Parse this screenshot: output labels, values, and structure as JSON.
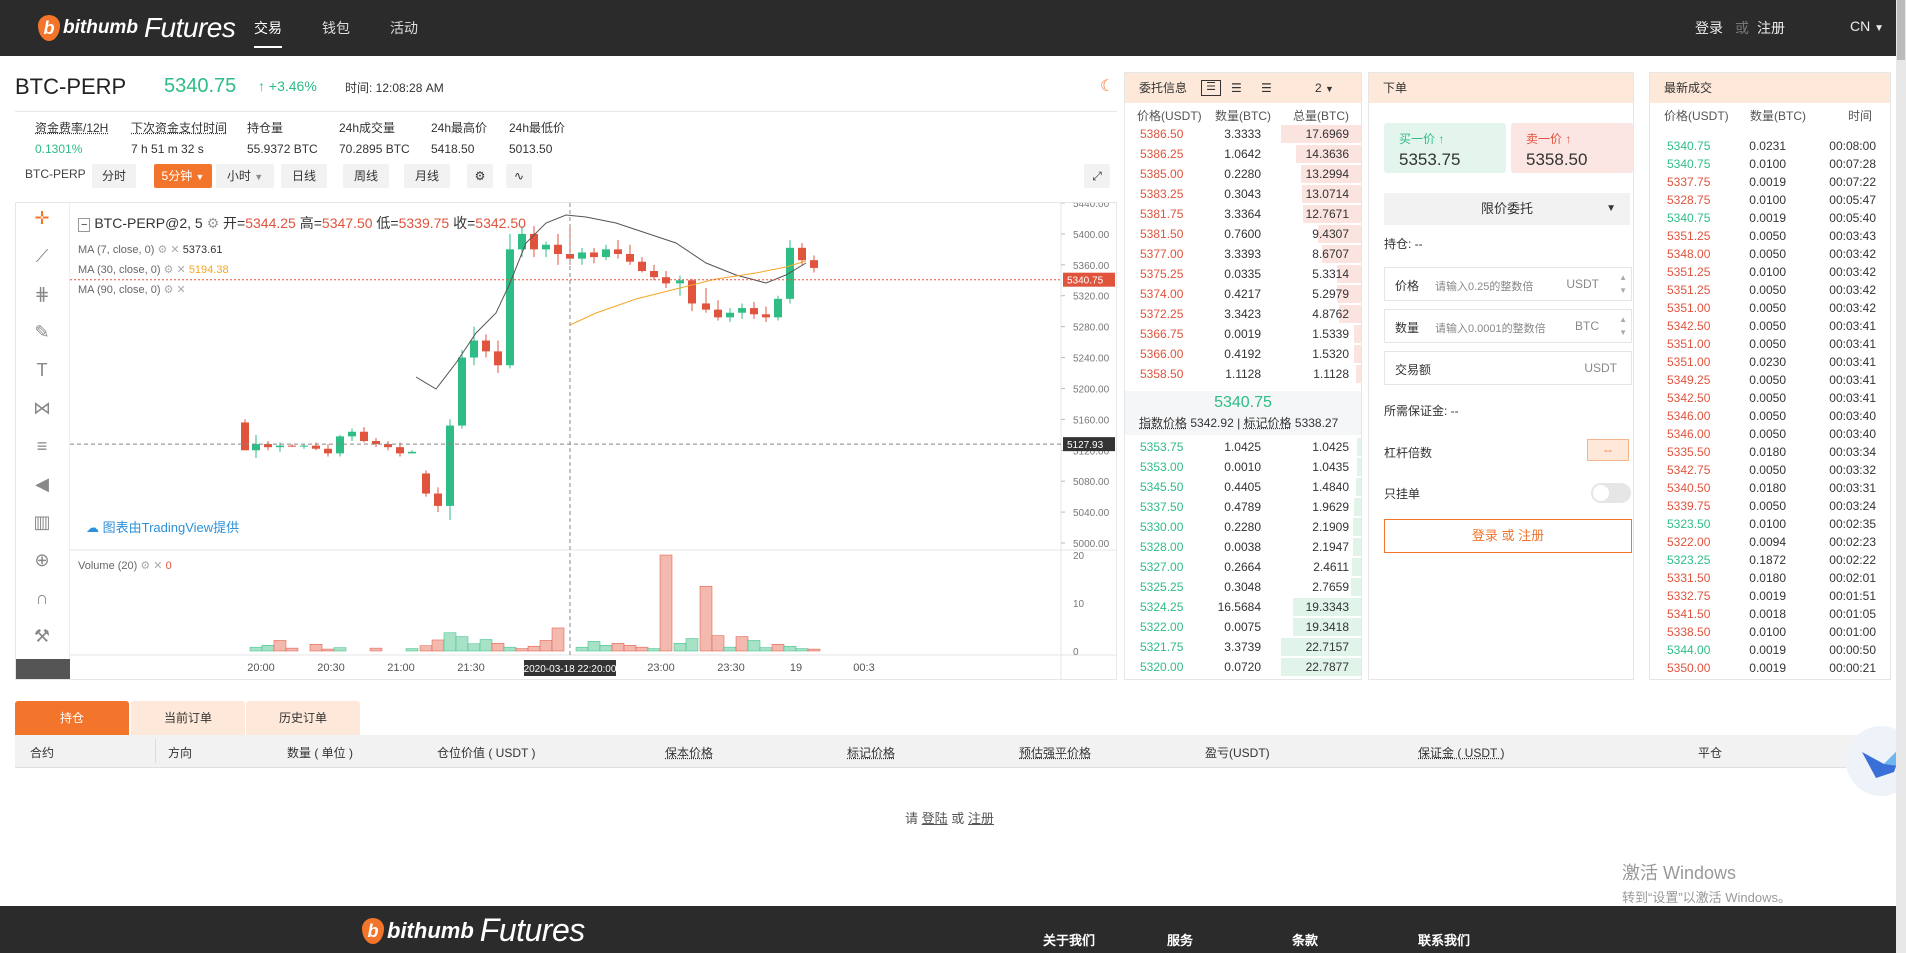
{
  "nav": {
    "logo_text1": "bithumb",
    "logo_text2": "Futures",
    "items": [
      {
        "label": "交易"
      },
      {
        "label": "钱包"
      },
      {
        "label": "活动"
      }
    ],
    "login": "登录",
    "or": "或",
    "register": "注册",
    "lang": "CN"
  },
  "header": {
    "symbol": "BTC-PERP",
    "last": "5340.75",
    "change": "↑ +3.46%",
    "time": "时间: 12:08:28 AM"
  },
  "stats": [
    {
      "label": "资金费率/12H",
      "value": "0.1301%"
    },
    {
      "label": "下次资金支付时间",
      "value": "7 h 51 m 32 s"
    },
    {
      "label": "持仓量",
      "value": "55.9372 BTC"
    },
    {
      "label": "24h成交量",
      "value": "70.2895 BTC"
    },
    {
      "label": "24h最高价",
      "value": "5418.50"
    },
    {
      "label": "24h最低价",
      "value": "5013.50"
    }
  ],
  "toolbar": {
    "symbol": "BTC-PERP",
    "intervals": [
      "分时",
      "5分钟",
      "小时",
      "日线",
      "周线",
      "月线"
    ],
    "active": "5分钟"
  },
  "chart": {
    "ohlc": {
      "title": "BTC-PERP@2, 5",
      "open_lbl": "开=",
      "open": "5344.25",
      "high_lbl": "高=",
      "high": "5347.50",
      "low_lbl": "低=",
      "low": "5339.75",
      "close_lbl": "收=",
      "close": "5342.50"
    },
    "ma": [
      {
        "label": "MA (7, close, 0)",
        "value": "5373.61",
        "color": "#333333"
      },
      {
        "label": "MA (30, close, 0)",
        "value": "5194.38",
        "color": "#f5a623"
      },
      {
        "label": "MA (90, close, 0)",
        "value": "",
        "color": "#999999"
      }
    ],
    "tradingview": "图表由TradingView提供",
    "volume": {
      "label": "Volume (20)",
      "value": "0"
    },
    "price_axis": [
      "5440.00",
      "5400.00",
      "5360.00",
      "5320.00",
      "5280.00",
      "5240.00",
      "5200.00",
      "5160.00",
      "5120.00",
      "5080.00",
      "5040.00",
      "5000.00"
    ],
    "current_tag": "5340.75",
    "cross_tag": "5127.93",
    "vol_axis": [
      "20",
      "10",
      "0"
    ],
    "time_axis": [
      "20:00",
      "20:30",
      "21:00",
      "21:30",
      "22",
      "23:00",
      "23:30",
      "19",
      "00:3"
    ],
    "cross_time": "2020-03-18 22:20:00"
  },
  "orderbook": {
    "title": "委托信息",
    "depth": "2",
    "cols": [
      "价格(USDT)",
      "数量(BTC)",
      "总量(BTC)"
    ],
    "asks": [
      [
        "5386.50",
        "3.3333",
        "17.6969"
      ],
      [
        "5386.25",
        "1.0642",
        "14.3636"
      ],
      [
        "5385.00",
        "0.2280",
        "13.2994"
      ],
      [
        "5383.25",
        "0.3043",
        "13.0714"
      ],
      [
        "5381.75",
        "3.3364",
        "12.7671"
      ],
      [
        "5381.50",
        "0.7600",
        "9.4307"
      ],
      [
        "5377.00",
        "3.3393",
        "8.6707"
      ],
      [
        "5375.25",
        "0.0335",
        "5.3314"
      ],
      [
        "5374.00",
        "0.4217",
        "5.2979"
      ],
      [
        "5372.25",
        "3.3423",
        "4.8762"
      ],
      [
        "5366.75",
        "0.0019",
        "1.5339"
      ],
      [
        "5366.00",
        "0.4192",
        "1.5320"
      ],
      [
        "5358.50",
        "1.1128",
        "1.1128"
      ]
    ],
    "mid": "5340.75",
    "index_lbl": "指数价格",
    "index_val": "5342.92",
    "mark_lbl": "标记价格",
    "mark_val": "5338.27",
    "bids": [
      [
        "5353.75",
        "1.0425",
        "1.0425"
      ],
      [
        "5353.00",
        "0.0010",
        "1.0435"
      ],
      [
        "5345.50",
        "0.4405",
        "1.4840"
      ],
      [
        "5337.50",
        "0.4789",
        "1.9629"
      ],
      [
        "5330.00",
        "0.2280",
        "2.1909"
      ],
      [
        "5328.00",
        "0.0038",
        "2.1947"
      ],
      [
        "5327.00",
        "0.2664",
        "2.4611"
      ],
      [
        "5325.25",
        "0.3048",
        "2.7659"
      ],
      [
        "5324.25",
        "16.5684",
        "19.3343"
      ],
      [
        "5322.00",
        "0.0075",
        "19.3418"
      ],
      [
        "5321.75",
        "3.3739",
        "22.7157"
      ],
      [
        "5320.00",
        "0.0720",
        "22.7877"
      ]
    ]
  },
  "order_entry": {
    "title": "下单",
    "buy_lbl": "买一价 ↑",
    "buy_val": "5353.75",
    "sell_lbl": "卖一价 ↑",
    "sell_val": "5358.50",
    "order_type": "限价委托",
    "position": "持仓: --",
    "price_lbl": "价格",
    "price_ph": "请输入0.25的整数倍",
    "price_unit": "USDT",
    "qty_lbl": "数量",
    "qty_ph": "请输入0.0001的整数倍",
    "qty_unit": "BTC",
    "amount_lbl": "交易额",
    "amount_unit": "USDT",
    "margin_req": "所需保证金: --",
    "leverage_lbl": "杠杆倍数",
    "leverage_val": "--",
    "post_only": "只挂单",
    "login_btn": "登录 或 注册"
  },
  "trades": {
    "title": "最新成交",
    "cols": [
      "价格(USDT)",
      "数量(BTC)",
      "时间"
    ],
    "rows": [
      [
        "5340.75",
        "0.0231",
        "00:08:00",
        "g"
      ],
      [
        "5340.75",
        "0.0100",
        "00:07:28",
        "g"
      ],
      [
        "5337.75",
        "0.0019",
        "00:07:22",
        "r"
      ],
      [
        "5328.75",
        "0.0100",
        "00:05:47",
        "r"
      ],
      [
        "5340.75",
        "0.0019",
        "00:05:40",
        "g"
      ],
      [
        "5351.25",
        "0.0050",
        "00:03:43",
        "r"
      ],
      [
        "5348.00",
        "0.0050",
        "00:03:42",
        "r"
      ],
      [
        "5351.25",
        "0.0100",
        "00:03:42",
        "r"
      ],
      [
        "5351.25",
        "0.0050",
        "00:03:42",
        "r"
      ],
      [
        "5351.00",
        "0.0050",
        "00:03:42",
        "r"
      ],
      [
        "5342.50",
        "0.0050",
        "00:03:41",
        "r"
      ],
      [
        "5351.00",
        "0.0050",
        "00:03:41",
        "r"
      ],
      [
        "5351.00",
        "0.0230",
        "00:03:41",
        "r"
      ],
      [
        "5349.25",
        "0.0050",
        "00:03:41",
        "r"
      ],
      [
        "5342.50",
        "0.0050",
        "00:03:41",
        "r"
      ],
      [
        "5346.00",
        "0.0050",
        "00:03:40",
        "r"
      ],
      [
        "5346.00",
        "0.0050",
        "00:03:40",
        "r"
      ],
      [
        "5335.50",
        "0.0180",
        "00:03:34",
        "r"
      ],
      [
        "5342.75",
        "0.0050",
        "00:03:32",
        "r"
      ],
      [
        "5340.50",
        "0.0180",
        "00:03:31",
        "r"
      ],
      [
        "5339.75",
        "0.0050",
        "00:03:24",
        "r"
      ],
      [
        "5323.50",
        "0.0100",
        "00:02:35",
        "g"
      ],
      [
        "5322.00",
        "0.0094",
        "00:02:23",
        "r"
      ],
      [
        "5323.25",
        "0.1872",
        "00:02:22",
        "g"
      ],
      [
        "5331.50",
        "0.0180",
        "00:02:01",
        "r"
      ],
      [
        "5332.75",
        "0.0019",
        "00:01:51",
        "r"
      ],
      [
        "5341.50",
        "0.0018",
        "00:01:05",
        "r"
      ],
      [
        "5338.50",
        "0.0100",
        "00:01:00",
        "r"
      ],
      [
        "5344.00",
        "0.0019",
        "00:00:50",
        "g"
      ],
      [
        "5350.00",
        "0.0019",
        "00:00:21",
        "r"
      ]
    ]
  },
  "bottom": {
    "tabs": [
      "持仓",
      "当前订单",
      "历史订单"
    ],
    "cols": [
      "合约",
      "方向",
      "数量 ( 单位 )",
      "仓位价值 ( USDT )",
      "保本价格",
      "标记价格",
      "预估强平价格",
      "盈亏(USDT)",
      "保证金 ( USDT )",
      "平仓"
    ],
    "empty_pre": "请",
    "empty_login": "登陆",
    "empty_or": "或",
    "empty_reg": "注册"
  },
  "windows": {
    "line1": "激活 Windows",
    "line2": "转到“设置”以激活 Windows。"
  },
  "footer": {
    "logo_text1": "bithumb",
    "logo_text2": "Futures",
    "links": [
      "关于我们",
      "服务",
      "条款",
      "联系我们"
    ]
  },
  "colors": {
    "accent": "#f3752b",
    "up": "#2ebd85",
    "down": "#e0533d",
    "nav_bg": "#2b2b2b"
  }
}
